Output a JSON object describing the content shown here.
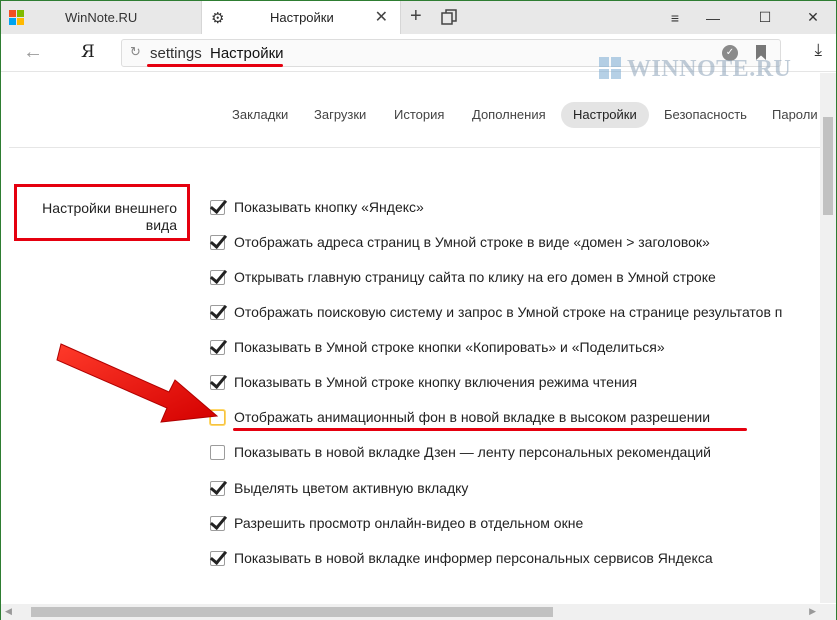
{
  "tabs": {
    "inactive_title": "WinNote.RU",
    "active_title": "Настройки"
  },
  "toolbar": {
    "yandex_button": "Я",
    "url_text": "settings",
    "url_page_title": "Настройки"
  },
  "watermark": "WINNOTE.RU",
  "settings_nav": [
    {
      "label": "Закладки",
      "active": false
    },
    {
      "label": "Загрузки",
      "active": false
    },
    {
      "label": "История",
      "active": false
    },
    {
      "label": "Дополнения",
      "active": false
    },
    {
      "label": "Настройки",
      "active": true
    },
    {
      "label": "Безопасность",
      "active": false
    },
    {
      "label": "Пароли",
      "active": false
    }
  ],
  "section_title": "Настройки внешнего вида",
  "options": [
    {
      "label": "Показывать кнопку «Яндекс»",
      "checked": true
    },
    {
      "label": "Отображать адреса страниц в Умной строке в виде «домен > заголовок»",
      "checked": true
    },
    {
      "label": "Открывать главную страницу сайта по клику на его домен в Умной строке",
      "checked": true
    },
    {
      "label": "Отображать поисковую систему и запрос в Умной строке на странице результатов п",
      "checked": true
    },
    {
      "label": "Показывать в Умной строке кнопки «Копировать» и «Поделиться»",
      "checked": true
    },
    {
      "label": "Показывать в Умной строке кнопку включения режима чтения",
      "checked": true
    },
    {
      "label": "Отображать анимационный фон в новой вкладке в высоком разрешении",
      "checked": false
    },
    {
      "label": "Показывать в новой вкладке Дзен — ленту персональных рекомендаций",
      "checked": false
    },
    {
      "label": "Выделять цветом активную вкладку",
      "checked": true
    },
    {
      "label": "Разрешить просмотр онлайн-видео в отдельном окне",
      "checked": true
    },
    {
      "label": "Показывать в новой вкладке информер персональных сервисов Яндекса",
      "checked": true
    }
  ],
  "colors": {
    "annotation_red": "#e5000f",
    "window_border": "#2e7d32"
  },
  "icons": [
    "windows-logo-icon",
    "gear-icon",
    "close-icon",
    "plus-icon",
    "tabs-icon",
    "minimize-icon",
    "maximize-icon",
    "back-arrow-icon",
    "reload-icon",
    "protect-icon",
    "bookmark-icon",
    "download-icon"
  ]
}
